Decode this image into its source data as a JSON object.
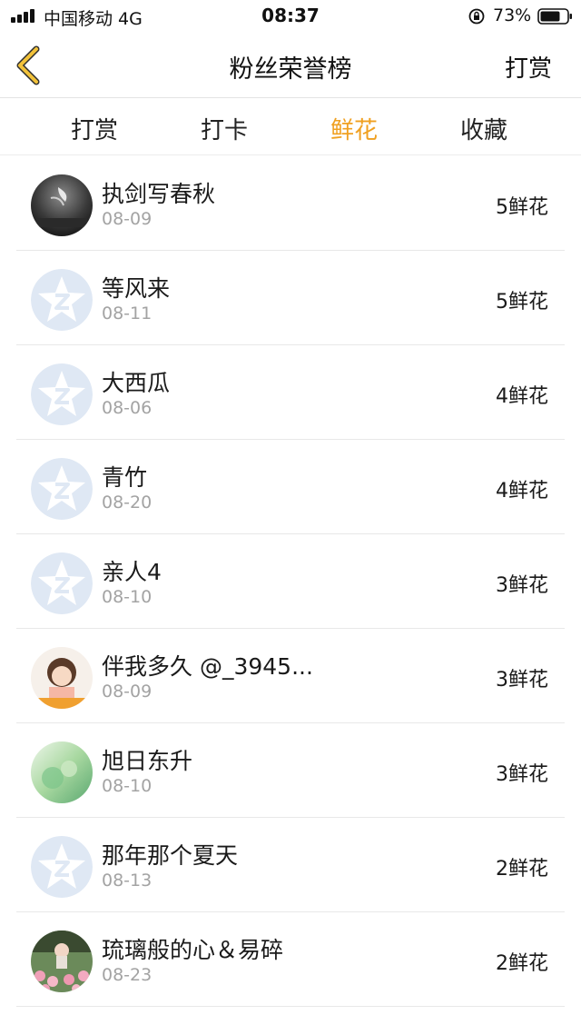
{
  "status_bar": {
    "carrier": "中国移动  4G",
    "time": "08:37",
    "battery": "73%"
  },
  "nav": {
    "title": "粉丝荣誉榜",
    "right_action": "打赏",
    "back_icon": "chevron-left-icon"
  },
  "tabs": [
    {
      "label": "打赏",
      "active": false
    },
    {
      "label": "打卡",
      "active": false
    },
    {
      "label": "鲜花",
      "active": true
    },
    {
      "label": "收藏",
      "active": false
    }
  ],
  "colors": {
    "accent": "#f0a020",
    "back_icon": "#f2c23a",
    "default_avatar": "#dfe8f4"
  },
  "fans": [
    {
      "name": "执剑写春秋",
      "date": "08-09",
      "count": "5鲜花",
      "avatar": "photo-dark"
    },
    {
      "name": "等风来",
      "date": "08-11",
      "count": "5鲜花",
      "avatar": "default"
    },
    {
      "name": "大西瓜",
      "date": "08-06",
      "count": "4鲜花",
      "avatar": "default"
    },
    {
      "name": "青竹",
      "date": "08-20",
      "count": "4鲜花",
      "avatar": "default"
    },
    {
      "name": "亲人4",
      "date": "08-10",
      "count": "3鲜花",
      "avatar": "default"
    },
    {
      "name": "伴我多久 @_3945...",
      "date": "08-09",
      "count": "3鲜花",
      "avatar": "photo-girl"
    },
    {
      "name": "旭日东升",
      "date": "08-10",
      "count": "3鲜花",
      "avatar": "photo-green"
    },
    {
      "name": "那年那个夏天",
      "date": "08-13",
      "count": "2鲜花",
      "avatar": "default"
    },
    {
      "name": "琉璃般的心＆易碎",
      "date": "08-23",
      "count": "2鲜花",
      "avatar": "photo-flowers"
    }
  ]
}
